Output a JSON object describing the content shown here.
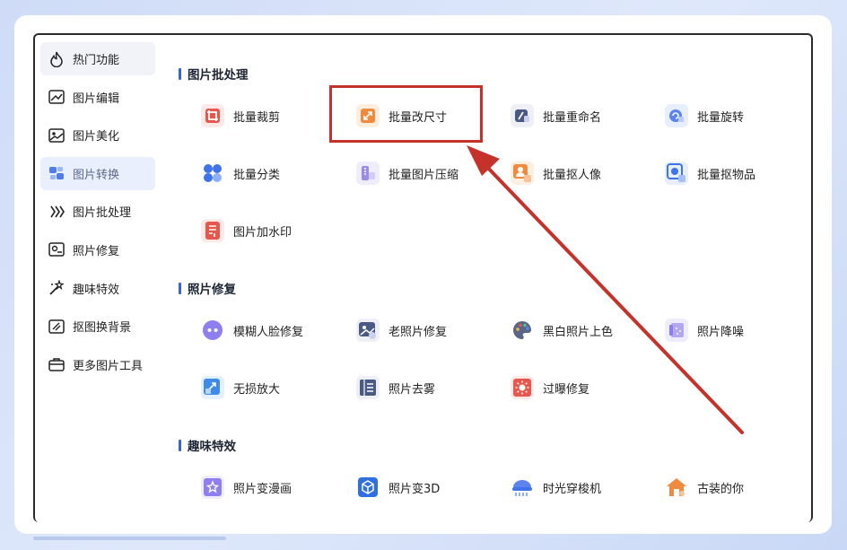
{
  "sidebar": {
    "items": [
      {
        "label": "热门功能",
        "icon": "fire-icon"
      },
      {
        "label": "图片编辑",
        "icon": "image-edit-icon"
      },
      {
        "label": "图片美化",
        "icon": "image-beautify-icon"
      },
      {
        "label": "图片转换",
        "icon": "convert-icon"
      },
      {
        "label": "图片批处理",
        "icon": "batch-icon"
      },
      {
        "label": "照片修复",
        "icon": "photo-repair-icon"
      },
      {
        "label": "趣味特效",
        "icon": "magic-icon"
      },
      {
        "label": "抠图换背景",
        "icon": "cutout-icon"
      },
      {
        "label": "更多图片工具",
        "icon": "toolbox-icon"
      }
    ]
  },
  "sections": {
    "batch": {
      "title": "图片批处理",
      "tools": [
        "批量裁剪",
        "批量改尺寸",
        "批量重命名",
        "批量旋转",
        "批量分类",
        "批量图片压缩",
        "批量抠人像",
        "批量抠物品",
        "图片加水印"
      ]
    },
    "repair": {
      "title": "照片修复",
      "tools": [
        "模糊人脸修复",
        "老照片修复",
        "黑白照片上色",
        "照片降噪",
        "无损放大",
        "照片去雾",
        "过曝修复"
      ]
    },
    "fun": {
      "title": "趣味特效",
      "tools": [
        "照片变漫画",
        "照片变3D",
        "时光穿梭机",
        "古装的你"
      ]
    }
  },
  "colors": {
    "highlight": "#c5322a",
    "accent": "#3a63d8",
    "active_bg": "#e9effc"
  }
}
